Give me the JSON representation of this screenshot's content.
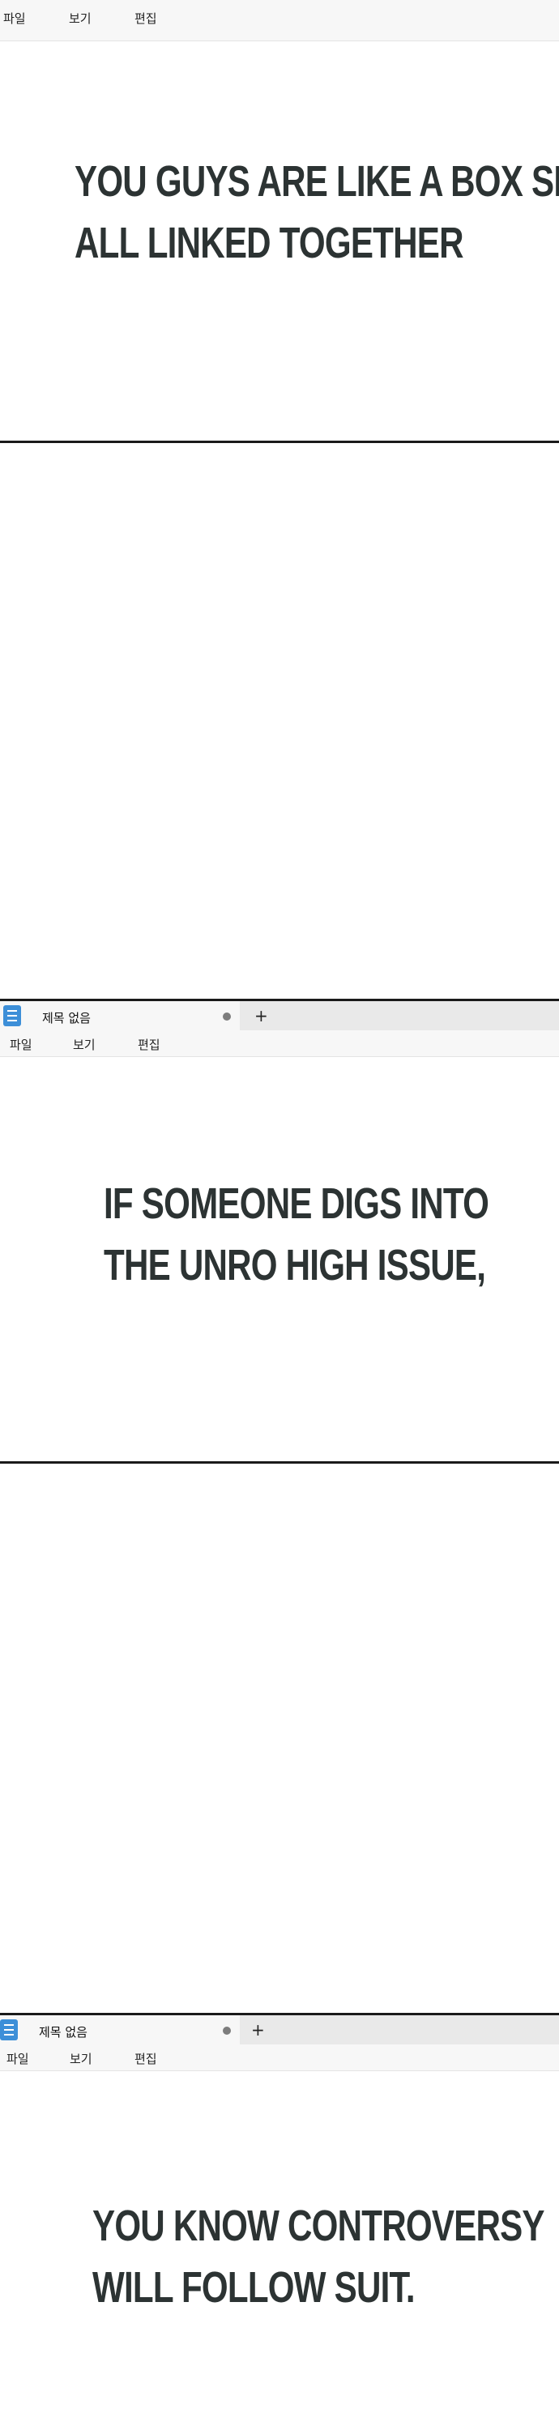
{
  "window": {
    "tab_title": "제목 없음",
    "new_tab_label": "+",
    "menu": [
      "파일",
      "보기",
      "편집"
    ]
  },
  "captions": {
    "panel1": [
      "YOU GUYS ARE LIKE A BOX SET,",
      "ALL LINKED TOGETHER"
    ],
    "panel3": [
      "IF SOMEONE DIGS INTO",
      "THE UNRO HIGH ISSUE,"
    ],
    "panel5": [
      "YOU KNOW CONTROVERSY",
      "WILL FOLLOW SUIT."
    ]
  },
  "colors": {
    "caption_text": "#2c3333",
    "tab_bar": "#e9e9e9",
    "active_tab": "#f7f7f7",
    "app_icon": "#3d8fd8",
    "panel_divider": "#1a1a1a"
  },
  "icons": {
    "app": "notepad-icon",
    "modified": "modified-dot-icon"
  }
}
